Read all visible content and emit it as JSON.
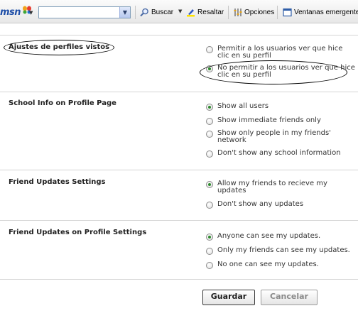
{
  "toolbar": {
    "logo_text": "msn",
    "search_value": "",
    "buscar_label": "Buscar",
    "resaltar_label": "Resaltar",
    "opciones_label": "Opciones",
    "ventanas_label": "Ventanas emergentes"
  },
  "sections": [
    {
      "title": "Ajustes de perfiles vistos",
      "options": [
        {
          "label": "Permitir a los usuarios ver que hice clic en su perfil",
          "selected": false
        },
        {
          "label": "No permitir a los usuarios ver que hice clic en su perfil",
          "selected": true
        }
      ]
    },
    {
      "title": "School Info on Profile Page",
      "options": [
        {
          "label": "Show all users",
          "selected": true
        },
        {
          "label": "Show immediate friends only",
          "selected": false
        },
        {
          "label": "Show only people in my friends' network",
          "selected": false
        },
        {
          "label": "Don't show any school information",
          "selected": false
        }
      ]
    },
    {
      "title": "Friend Updates Settings",
      "options": [
        {
          "label": "Allow my friends to recieve my updates",
          "selected": true
        },
        {
          "label": "Don't show any updates",
          "selected": false
        }
      ]
    },
    {
      "title": "Friend Updates on Profile Settings",
      "options": [
        {
          "label": "Anyone can see my updates.",
          "selected": true
        },
        {
          "label": "Only my friends can see my updates.",
          "selected": false
        },
        {
          "label": "No one can see my updates.",
          "selected": false
        }
      ]
    }
  ],
  "buttons": {
    "save_label": "Guardar",
    "cancel_label": "Cancelar"
  },
  "colors": {
    "radio_selected": "#2f8a2f",
    "toolbar_bg": "#eeeeee",
    "msn_blue": "#1e4ea7"
  }
}
